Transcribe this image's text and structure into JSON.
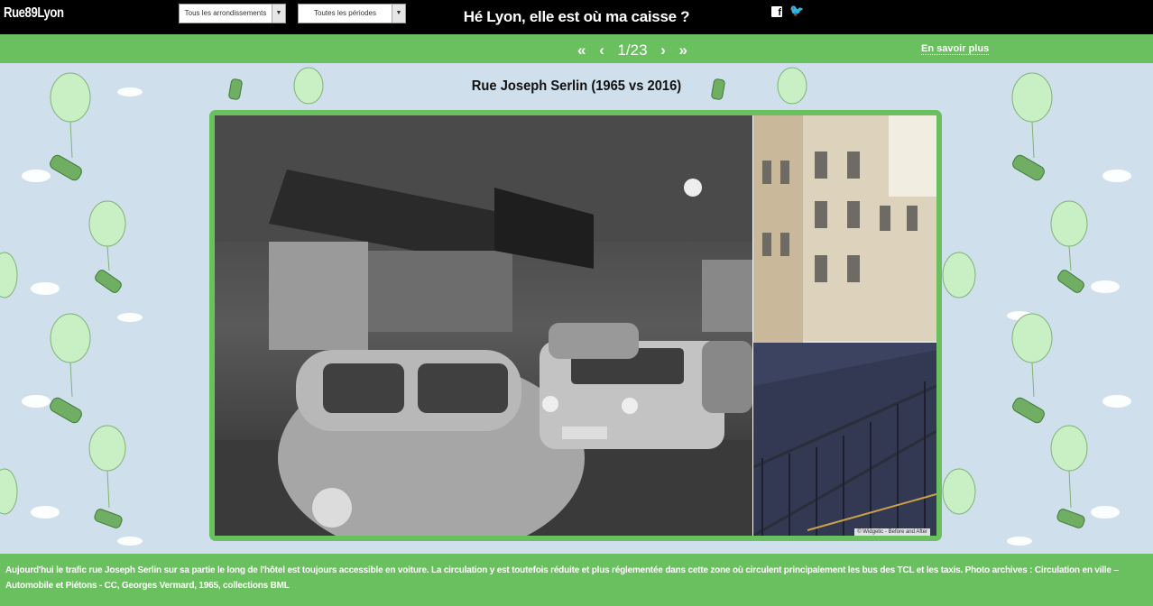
{
  "header": {
    "logo": "Rue89Lyon",
    "title": "Hé Lyon, elle est où ma caisse ?",
    "social": [
      {
        "icon": "facebook-icon",
        "glyph": "f"
      },
      {
        "icon": "twitter-icon",
        "glyph": "🐦"
      }
    ]
  },
  "nav": {
    "filter_arrondissements": "Tous les arrondissements",
    "filter_periodes": "Toutes les périodes",
    "first_glyph": "«",
    "prev_glyph": "‹",
    "page_current": "1",
    "page_total": "23",
    "next_glyph": "›",
    "last_glyph": "»",
    "more_link": "En savoir plus"
  },
  "slide": {
    "title": "Rue Joseph Serlin (1965 vs 2016)",
    "credit": "© Widgetic - Before and After",
    "caption": "Aujourd'hui le trafic rue Joseph Serlin sur sa partie le long de l'hôtel est toujours accessible en voiture. La circulation y est toutefois réduite et plus réglementée dans cette zone où circulent principalement les bus des TCL et les taxis. Photo archives : Circulation en ville – Automobile et Piétons - CC, Georges Vermard, 1965, collections BML"
  },
  "colors": {
    "accent_green": "#6abf5e",
    "background": "#cfe0ec",
    "topbar": "#000000"
  }
}
